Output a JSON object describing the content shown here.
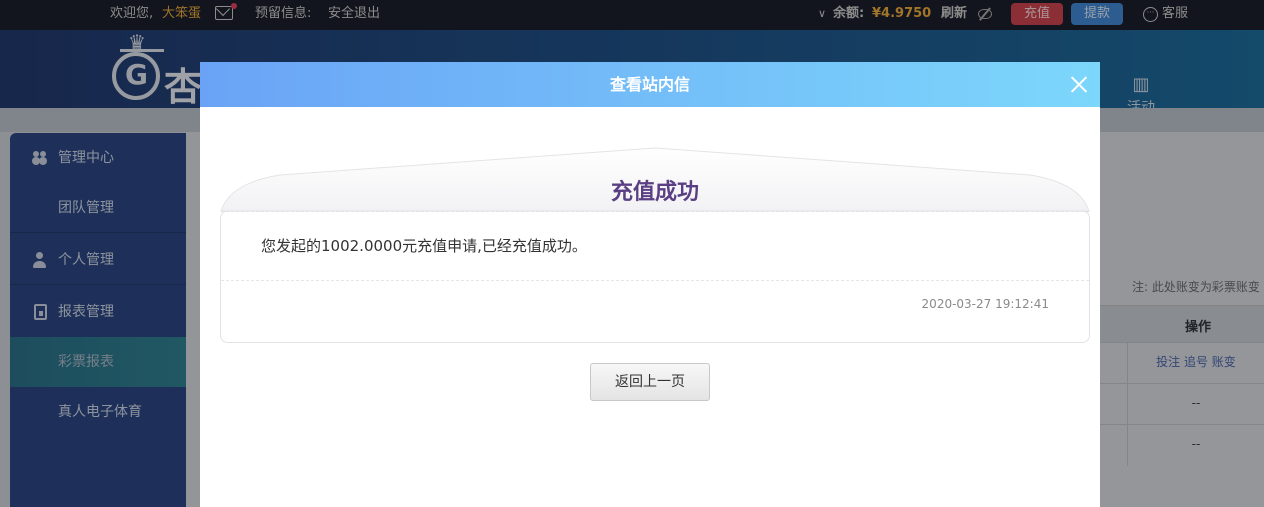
{
  "topbar": {
    "welcome": "欢迎您,",
    "username": "大笨蛋",
    "reserved_info": "预留信息:",
    "logout": "安全退出",
    "balance_label": "余额:",
    "balance_value": "¥4.9750",
    "refresh": "刷新",
    "recharge": "充值",
    "withdraw": "提款",
    "service": "客服"
  },
  "logo": {
    "text": "杏"
  },
  "nav": {
    "activity_label": "活动"
  },
  "sidebar": {
    "items": [
      {
        "label": "管理中心",
        "icon": "users-icon"
      },
      {
        "label": "团队管理"
      },
      {
        "label": "个人管理",
        "icon": "user-icon"
      },
      {
        "label": "报表管理",
        "icon": "report-icon"
      },
      {
        "label": "彩票报表"
      },
      {
        "label": "真人电子体育"
      }
    ]
  },
  "right_panel": {
    "note": "注: 此处账变为彩票账变",
    "column_header": "操作",
    "rows": [
      {
        "links": "投注 追号 账变"
      },
      {
        "value": "--"
      },
      {
        "value": "--"
      }
    ]
  },
  "modal": {
    "title": "查看站内信",
    "message_title": "充值成功",
    "message_body": "您发起的1002.0000元充值申请,已经充值成功。",
    "timestamp": "2020-03-27 19:12:41",
    "back_button": "返回上一页"
  },
  "colors": {
    "header_gradient_start": "#6aa3f6",
    "header_gradient_end": "#7cd7fb",
    "message_title": "#5b3f84",
    "accent_gold": "#e6a63c"
  }
}
